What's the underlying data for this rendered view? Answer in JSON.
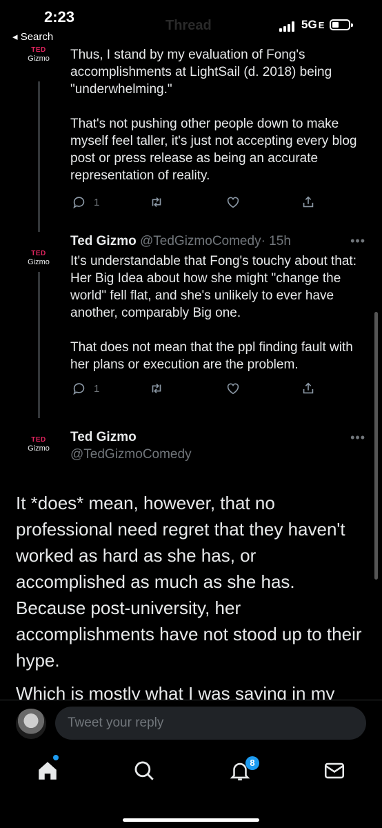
{
  "status_bar": {
    "time": "2:23",
    "back_label": "◂ Search",
    "network": "5G",
    "network_suffix": "E",
    "ghost_title": "Thread"
  },
  "tweets": [
    {
      "avatar_line1": "TED",
      "avatar_line2": "Gizmo",
      "text": "Thus, I stand by my evaluation of Fong's accomplishments at LightSail (d. 2018) being \"underwhelming.\"\n\nThat's not pushing other people down to make myself feel taller, it's just not accepting every blog post or press release as being an accurate representation of reality.",
      "reply_count": "1"
    },
    {
      "avatar_line1": "TED",
      "avatar_line2": "Gizmo",
      "name": "Ted Gizmo",
      "handle": "@TedGizmoComedy",
      "time": "· 15h",
      "text": "It's understandable that Fong's touchy about that: Her Big Idea about how she might \"change the world\" fell flat, and she's unlikely to ever have another, comparably Big one.\n\nThat does not mean that the ppl finding fault with her plans or execution are the problem.",
      "reply_count": "1"
    }
  ],
  "focus_tweet": {
    "avatar_line1": "TED",
    "avatar_line2": "Gizmo",
    "name": "Ted Gizmo",
    "handle": "@TedGizmoComedy",
    "text": "It *does* mean, however, that no professional need regret that they haven't worked as hard as she has, or accomplished as much as she has. Because post-university, her accomplishments have not stood up to their hype.",
    "cut_text": "Which is mostly what I was saying in my"
  },
  "reply_bar": {
    "placeholder": "Tweet your reply"
  },
  "tab_bar": {
    "notifications_badge": "8"
  },
  "colors": {
    "background": "#000000",
    "text": "#e7e9ea",
    "muted": "#71767b",
    "accent": "#1d9bf0",
    "avatar_red": "#e0245e"
  },
  "icons": [
    "reply-icon",
    "retweet-icon",
    "like-icon",
    "share-icon",
    "home-icon",
    "search-icon",
    "bell-icon",
    "mail-icon",
    "more-icon"
  ]
}
